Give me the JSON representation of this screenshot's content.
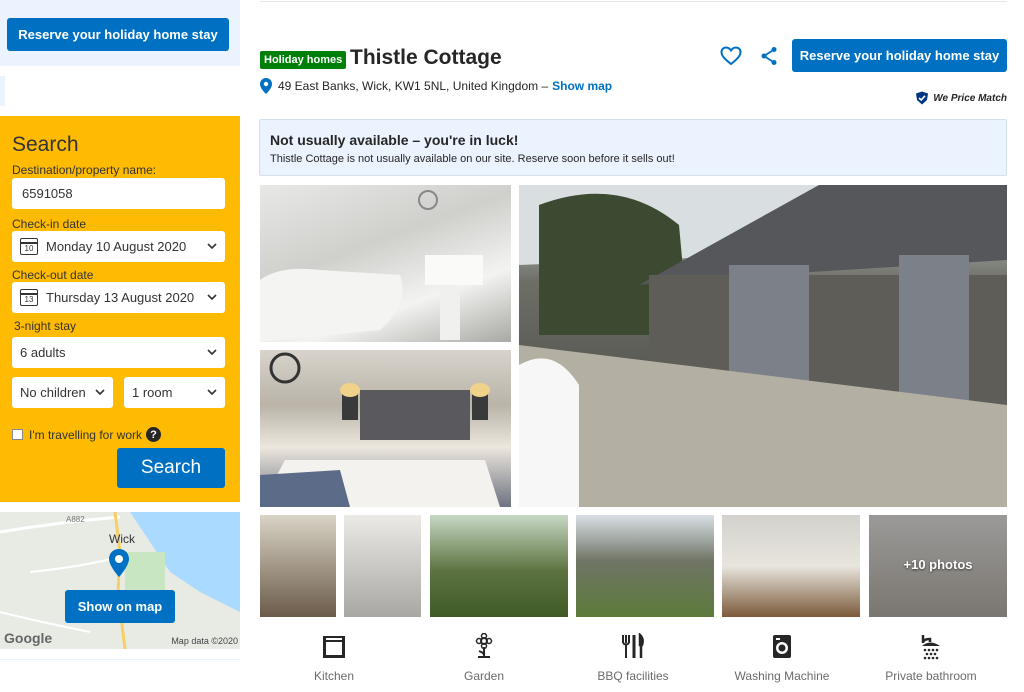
{
  "sidebar": {
    "reserve_label": "Reserve your holiday home stay",
    "search": {
      "title": "Search",
      "destination_label": "Destination/property name:",
      "destination_value": "6591058",
      "checkin_label": "Check-in date",
      "checkin_value": "Monday 10 August 2020",
      "checkin_day": "10",
      "checkout_label": "Check-out date",
      "checkout_value": "Thursday 13 August 2020",
      "checkout_day": "13",
      "stay_length": "3-night stay",
      "adults": "6 adults",
      "children": "No children",
      "rooms": "1 room",
      "work_label": "I'm travelling for work",
      "help_glyph": "?",
      "button_label": "Search"
    },
    "map": {
      "town_label": "Wick",
      "road_label": "A882",
      "button_label": "Show on map",
      "credit": "Map data ©2020",
      "google_logo": "Google"
    }
  },
  "property": {
    "badge": "Holiday homes",
    "name": "Thistle Cottage",
    "address": "49 East Banks, Wick, KW1 5NL, United Kingdom –",
    "show_map_label": "Show map",
    "reserve_label": "Reserve your holiday home stay",
    "price_match": "We Price Match"
  },
  "alert": {
    "title": "Not usually available – you're in luck!",
    "text": "Thistle Cottage is not usually available on our site. Reserve soon before it sells out!"
  },
  "photos": {
    "more_label": "+10 photos"
  },
  "amenities": [
    {
      "label": "Kitchen",
      "icon": "kitchen-icon"
    },
    {
      "label": "Garden",
      "icon": "garden-icon"
    },
    {
      "label": "BBQ facilities",
      "icon": "bbq-icon"
    },
    {
      "label": "Washing Machine",
      "icon": "washing-machine-icon"
    },
    {
      "label": "Private bathroom",
      "icon": "shower-icon"
    }
  ],
  "colors": {
    "accent": "#0071c2",
    "search_bg": "#febb02",
    "badge_bg": "#008009",
    "alert_bg": "#ebf3ff"
  }
}
